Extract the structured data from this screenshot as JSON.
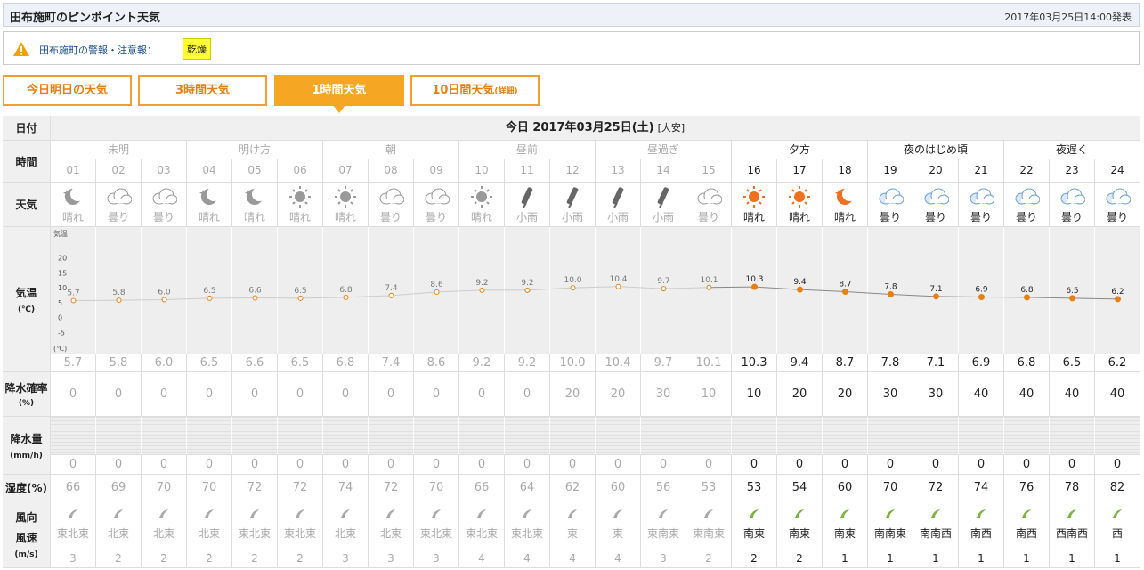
{
  "header": {
    "title": "田布施町のピンポイント天気",
    "issued": "2017年03月25日14:00発表"
  },
  "warning": {
    "label": "田布施町の警報・注意報：",
    "badge": "乾燥"
  },
  "tabs": [
    {
      "label": "今日明日の天気",
      "suffix": "",
      "active": false
    },
    {
      "label": "3時間天気",
      "suffix": "",
      "active": false
    },
    {
      "label": "1時間天気",
      "suffix": "",
      "active": true
    },
    {
      "label": "10日間天気",
      "suffix": "(詳細)",
      "active": false
    }
  ],
  "table": {
    "labels": {
      "date": "日付",
      "time": "時間",
      "weather": "天気",
      "temp": "気温",
      "temp_unit": "(℃)",
      "precip_prob": "降水確率",
      "precip_prob_unit": "(%)",
      "precip_amt": "降水量",
      "precip_amt_unit": "(mm/h)",
      "humidity": "湿度(%)",
      "wind_dir": "風向",
      "wind_speed": "風速",
      "wind_unit": "(m/s)"
    },
    "date_header": "今日 2017年03月25日(土)",
    "rokuyo": "[大安]",
    "periods": [
      "未明",
      "明け方",
      "朝",
      "昼前",
      "昼過ぎ",
      "夕方",
      "夜のはじめ頃",
      "夜遅く"
    ],
    "hours": [
      "01",
      "02",
      "03",
      "04",
      "05",
      "06",
      "07",
      "08",
      "09",
      "10",
      "11",
      "12",
      "13",
      "14",
      "15",
      "16",
      "17",
      "18",
      "19",
      "20",
      "21",
      "22",
      "23",
      "24"
    ],
    "weather": [
      "晴れ",
      "曇り",
      "曇り",
      "晴れ",
      "晴れ",
      "晴れ",
      "晴れ",
      "曇り",
      "曇り",
      "晴れ",
      "小雨",
      "小雨",
      "小雨",
      "小雨",
      "曇り",
      "晴れ",
      "晴れ",
      "晴れ",
      "曇り",
      "曇り",
      "曇り",
      "曇り",
      "曇り",
      "曇り"
    ],
    "weather_icons": [
      "moon-icon",
      "cloud-icon",
      "cloud-icon",
      "moon-icon",
      "moon-icon",
      "sun-icon",
      "sun-icon",
      "cloud-icon",
      "cloud-icon",
      "sun-icon",
      "umbrella-icon",
      "umbrella-icon",
      "umbrella-icon",
      "umbrella-icon",
      "cloud-icon",
      "sun-icon",
      "sun-icon",
      "moon-icon",
      "cloud-icon",
      "cloud-icon",
      "cloud-icon",
      "cloud-icon",
      "cloud-icon",
      "cloud-icon"
    ],
    "temps": [
      "5.7",
      "5.8",
      "6.0",
      "6.5",
      "6.6",
      "6.5",
      "6.8",
      "7.4",
      "8.6",
      "9.2",
      "9.2",
      "10.0",
      "10.4",
      "9.7",
      "10.1",
      "10.3",
      "9.4",
      "8.7",
      "7.8",
      "7.1",
      "6.9",
      "6.8",
      "6.5",
      "6.2"
    ],
    "precip_prob": [
      "0",
      "0",
      "0",
      "0",
      "0",
      "0",
      "0",
      "0",
      "0",
      "0",
      "0",
      "20",
      "20",
      "30",
      "10",
      "10",
      "20",
      "20",
      "30",
      "30",
      "40",
      "40",
      "40",
      "40"
    ],
    "precip_amt": [
      "0",
      "0",
      "0",
      "0",
      "0",
      "0",
      "0",
      "0",
      "0",
      "0",
      "0",
      "0",
      "0",
      "0",
      "0",
      "0",
      "0",
      "0",
      "0",
      "0",
      "0",
      "0",
      "0",
      "0"
    ],
    "humidity": [
      "66",
      "69",
      "70",
      "70",
      "72",
      "72",
      "74",
      "72",
      "70",
      "66",
      "64",
      "62",
      "60",
      "56",
      "53",
      "53",
      "54",
      "60",
      "70",
      "72",
      "74",
      "76",
      "78",
      "82"
    ],
    "wind_dir": [
      "東北東",
      "北東",
      "北東",
      "北東",
      "東北東",
      "東北東",
      "北東",
      "北東",
      "東北東",
      "東北東",
      "東北東",
      "東",
      "東",
      "東南東",
      "東南東",
      "南東",
      "南東",
      "南東",
      "南南東",
      "南南西",
      "南西",
      "南西",
      "西南西",
      "西"
    ],
    "wind_speed": [
      "3",
      "2",
      "2",
      "2",
      "2",
      "2",
      "3",
      "3",
      "3",
      "4",
      "4",
      "4",
      "4",
      "3",
      "2",
      "2",
      "2",
      "1",
      "1",
      "1",
      "1",
      "1",
      "1",
      "1"
    ],
    "current_from_hour": "16"
  },
  "chart_data": {
    "type": "line",
    "x": [
      "01",
      "02",
      "03",
      "04",
      "05",
      "06",
      "07",
      "08",
      "09",
      "10",
      "11",
      "12",
      "13",
      "14",
      "15",
      "16",
      "17",
      "18",
      "19",
      "20",
      "21",
      "22",
      "23",
      "24"
    ],
    "series": [
      {
        "name": "気温",
        "values": [
          5.7,
          5.8,
          6.0,
          6.5,
          6.6,
          6.5,
          6.8,
          7.4,
          8.6,
          9.2,
          9.2,
          10.0,
          10.4,
          9.7,
          10.1,
          10.3,
          9.4,
          8.7,
          7.8,
          7.1,
          6.9,
          6.8,
          6.5,
          6.2
        ]
      }
    ],
    "ylabel": "気温",
    "yunit": "(℃)",
    "yticks": [
      "20",
      "15",
      "10",
      "5",
      "0",
      "-5"
    ],
    "ylim": [
      -10,
      25
    ],
    "grid": true,
    "colors": {
      "past_line": "#cccccc",
      "future_line": "#888888",
      "point": "#e87f10"
    }
  },
  "colors": {
    "accent": "#f5a623",
    "label_bg": "#f0f0f0",
    "warning_badge": "#ffff33",
    "wind_future": "#7cb342"
  }
}
